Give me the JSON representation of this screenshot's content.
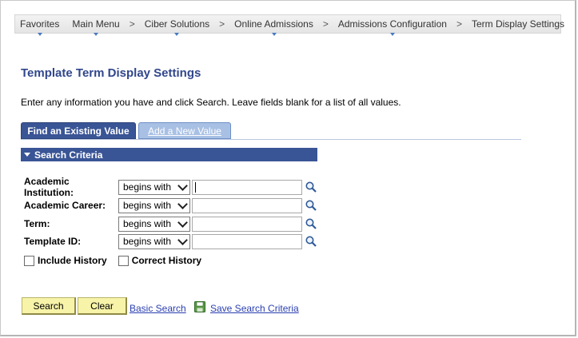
{
  "breadcrumb": {
    "items": [
      {
        "label": "Favorites"
      },
      {
        "label": "Main Menu"
      },
      {
        "label": "Ciber Solutions"
      },
      {
        "label": "Online Admissions"
      },
      {
        "label": "Admissions Configuration"
      },
      {
        "label": "Term Display Settings"
      }
    ],
    "separator": ">"
  },
  "page": {
    "title": "Template Term Display Settings",
    "instructions": "Enter any information you have and click Search. Leave fields blank for a list of all values."
  },
  "tabs": [
    {
      "label": "Find an Existing Value",
      "active": true
    },
    {
      "label": "Add a New Value",
      "active": false
    }
  ],
  "search_criteria": {
    "header": "Search Criteria",
    "fields": [
      {
        "label": "Academic Institution:",
        "operator": "begins with",
        "value": ""
      },
      {
        "label": "Academic Career:",
        "operator": "begins with",
        "value": ""
      },
      {
        "label": "Term:",
        "operator": "begins with",
        "value": ""
      },
      {
        "label": "Template ID:",
        "operator": "begins with",
        "value": ""
      }
    ],
    "checkboxes": [
      {
        "label": "Include History",
        "checked": false
      },
      {
        "label": "Correct History",
        "checked": false
      }
    ]
  },
  "actions": {
    "search": "Search",
    "clear": "Clear",
    "basic_search": "Basic Search",
    "save_search": "Save Search Criteria"
  },
  "colors": {
    "header_blue": "#3a5596",
    "title_blue": "#31478c",
    "button_yellow": "#f7f3a8",
    "link_blue": "#2a3fb0"
  }
}
